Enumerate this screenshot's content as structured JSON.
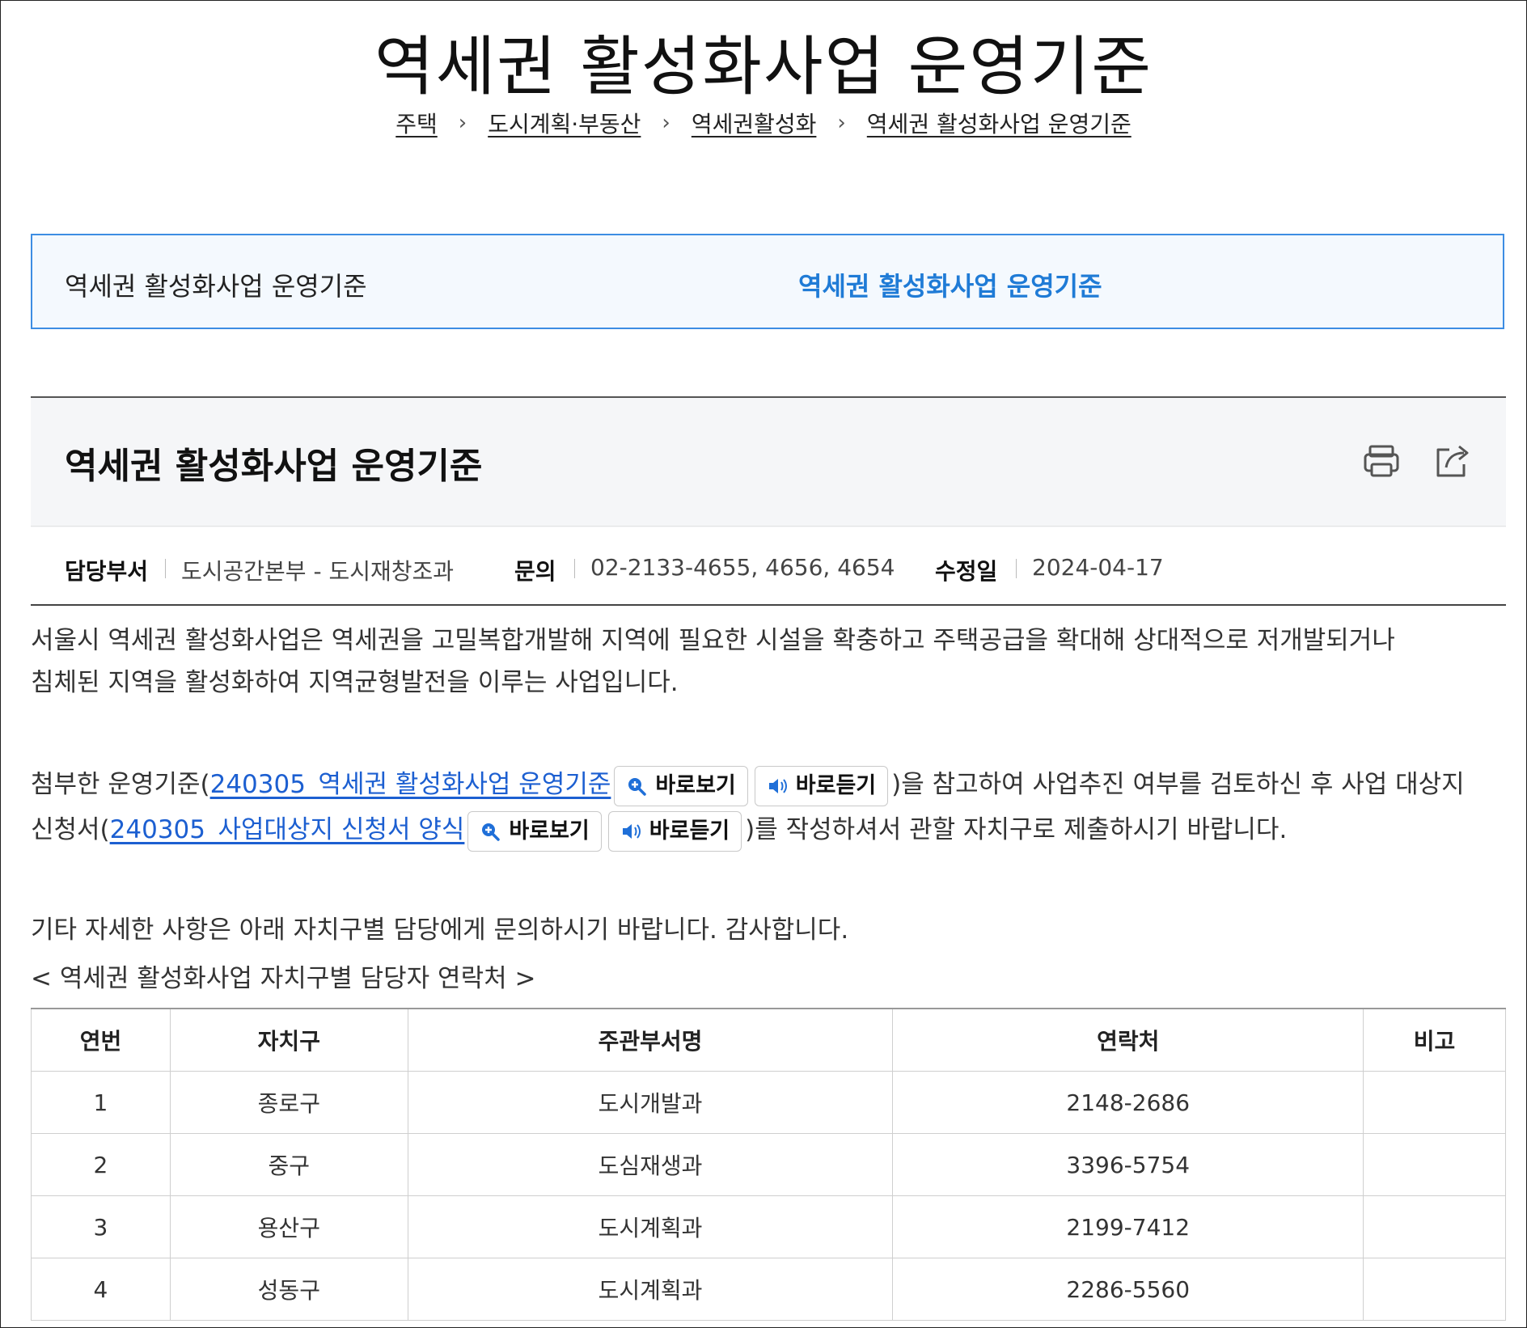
{
  "page_title": "역세권 활성화사업 운영기준",
  "breadcrumb": [
    "주택",
    "도시계획·부동산",
    "역세권활성화",
    "역세권 활성화사업 운영기준"
  ],
  "breadcrumb_separator": "›",
  "notice": {
    "left_text": "역세권 활성화사업 운영기준",
    "link_text": "역세권 활성화사업 운영기준"
  },
  "article": {
    "title": "역세권 활성화사업 운영기준",
    "print_icon": "printer-icon",
    "share_icon": "share-icon"
  },
  "meta": {
    "dept_label": "담당부서",
    "dept_value": "도시공간본부 - 도시재창조과",
    "contact_label": "문의",
    "contact_value": "02-2133-4655, 4656, 4654",
    "modified_label": "수정일",
    "modified_value": "2024-04-17"
  },
  "body": {
    "intro_line1": "서울시 역세권 활성화사업은 역세권을 고밀복합개발해 지역에 필요한 시설을 확충하고 주택공급을 확대해 상대적으로 저개발되거나",
    "intro_line2": "침체된 지역을 활성화하여 지역균형발전을 이루는 사업입니다.",
    "attach_prefix": "첨부한 운영기준(",
    "attach1_name": "240305_역세권 활성화사업 운영기준",
    "view_label": "바로보기",
    "listen_label": "바로듣기",
    "attach_middle": ")을 참고하여 사업추진 여부를 검토하신 후 사업 대상지",
    "attach_line2_prefix": "신청서(",
    "attach2_name": "240305_사업대상지 신청서 양식",
    "attach_suffix": ")를 작성하셔서 관할 자치구로 제출하시기 바랍니다.",
    "closing": "기타 자세한 사항은 아래 자치구별 담당에게 문의하시기 바랍니다. 감사합니다.",
    "table_caption": "< 역세권 활성화사업 자치구별 담당자 연락처 >"
  },
  "table": {
    "headers": [
      "연번",
      "자치구",
      "주관부서명",
      "연락처",
      "비고"
    ],
    "rows": [
      [
        "1",
        "종로구",
        "도시개발과",
        "2148-2686",
        ""
      ],
      [
        "2",
        "중구",
        "도심재생과",
        "3396-5754",
        ""
      ],
      [
        "3",
        "용산구",
        "도시계획과",
        "2199-7412",
        ""
      ],
      [
        "4",
        "성동구",
        "도시계획과",
        "2286-5560",
        ""
      ]
    ]
  },
  "colors": {
    "accent_blue": "#1f7bd6",
    "link_blue": "#1c5fd1",
    "notice_border": "#3d8de3"
  }
}
